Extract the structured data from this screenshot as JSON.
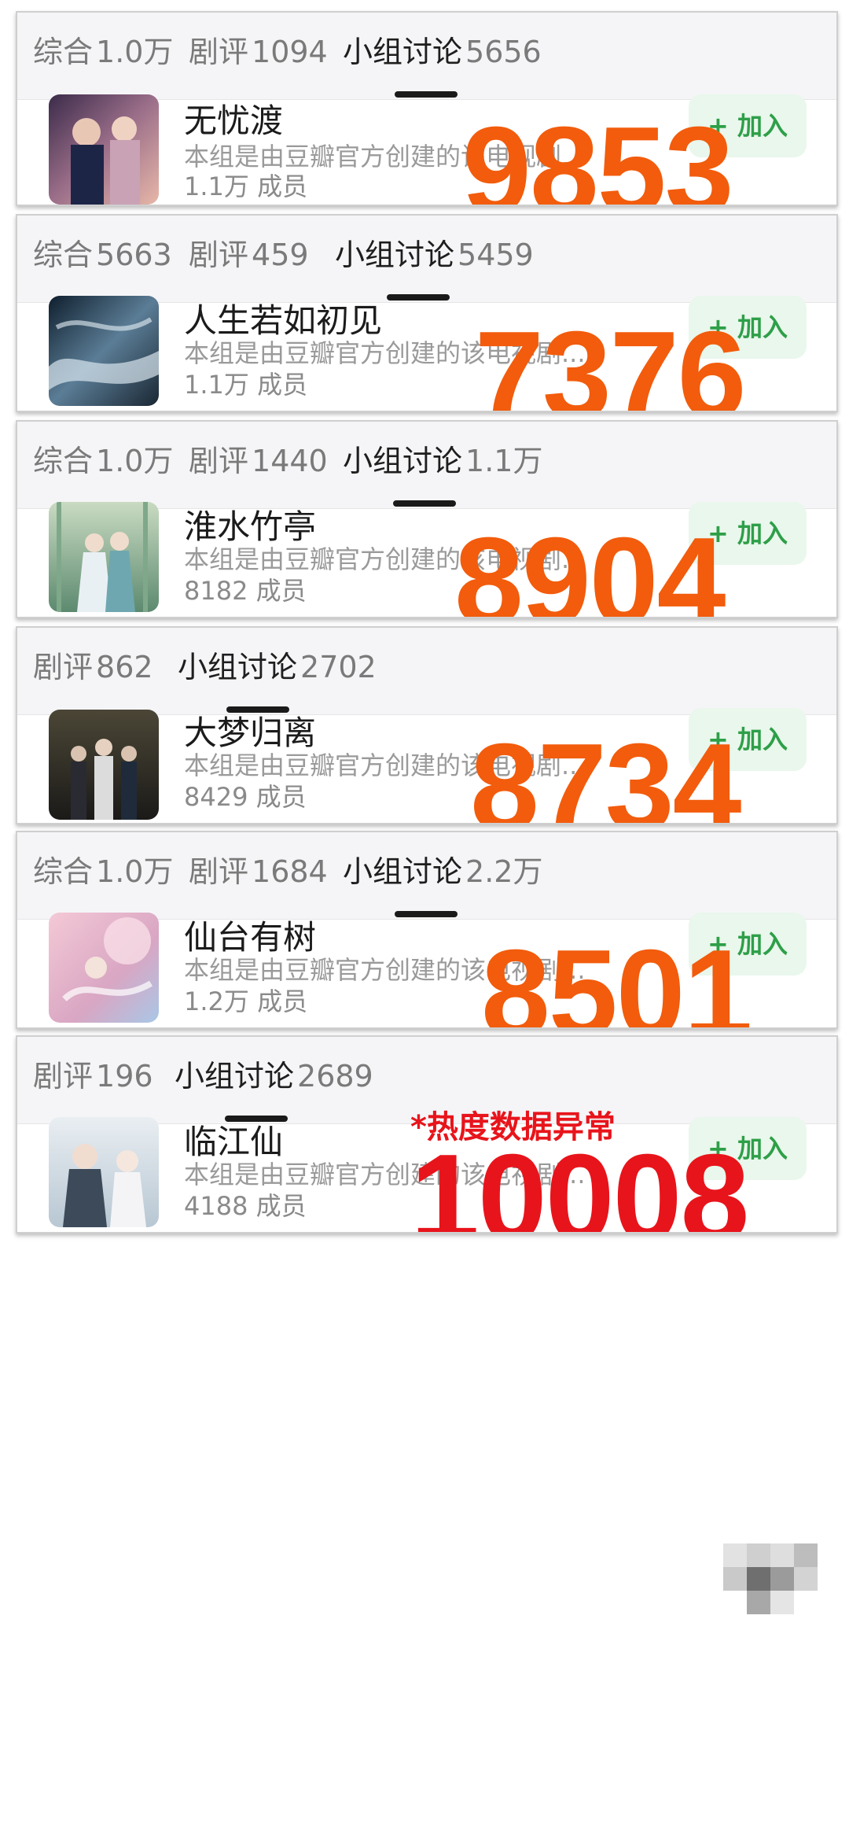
{
  "cards": [
    {
      "tabs": [
        {
          "label": "综合",
          "count": "1.0万",
          "active": false
        },
        {
          "label": "剧评",
          "count": "1094",
          "active": false
        },
        {
          "label": "小组讨论",
          "count": "5656",
          "active": true
        }
      ],
      "name": "无忧渡",
      "desc": "本组是由豆瓣官方创建的该电视剧...",
      "members": "1.1万 成员",
      "join": "+ 加入",
      "overlay": "9853"
    },
    {
      "tabs": [
        {
          "label": "综合",
          "count": "5663",
          "active": false
        },
        {
          "label": "剧评",
          "count": "459",
          "active": false
        },
        {
          "label": "小组讨论",
          "count": "5459",
          "active": true
        }
      ],
      "name": "人生若如初见",
      "desc": "本组是由豆瓣官方创建的该电视剧...",
      "members": "1.1万 成员",
      "join": "+ 加入",
      "overlay": "7376"
    },
    {
      "tabs": [
        {
          "label": "综合",
          "count": "1.0万",
          "active": false
        },
        {
          "label": "剧评",
          "count": "1440",
          "active": false
        },
        {
          "label": "小组讨论",
          "count": "1.1万",
          "active": true
        }
      ],
      "name": "淮水竹亭",
      "desc": "本组是由豆瓣官方创建的该电视剧...",
      "members": "8182 成员",
      "join": "+ 加入",
      "overlay": "8904"
    },
    {
      "tabs": [
        {
          "label": "剧评",
          "count": "862",
          "active": false
        },
        {
          "label": "小组讨论",
          "count": "2702",
          "active": true
        }
      ],
      "name": "大梦归离",
      "desc": "本组是由豆瓣官方创建的该电视剧...",
      "members": "8429 成员",
      "join": "+ 加入",
      "overlay": "8734"
    },
    {
      "tabs": [
        {
          "label": "综合",
          "count": "1.0万",
          "active": false
        },
        {
          "label": "剧评",
          "count": "1684",
          "active": false
        },
        {
          "label": "小组讨论",
          "count": "2.2万",
          "active": true
        }
      ],
      "name": "仙台有树",
      "desc": "本组是由豆瓣官方创建的该电视剧...",
      "members": "1.2万 成员",
      "join": "+ 加入",
      "overlay": "8501"
    },
    {
      "tabs": [
        {
          "label": "剧评",
          "count": "196",
          "active": false
        },
        {
          "label": "小组讨论",
          "count": "2689",
          "active": true
        }
      ],
      "name": "临江仙",
      "desc": "本组是由豆瓣官方创建的该电视剧...",
      "members": "4188 成员",
      "join": "+ 加入",
      "overlay": "10008",
      "note": "*热度数据异常"
    }
  ],
  "colors": {
    "overlay_orange": "#f25c0c",
    "overlay_red": "#e8141b",
    "join_green": "#2e9f48",
    "join_bg": "#e9f7ec"
  }
}
